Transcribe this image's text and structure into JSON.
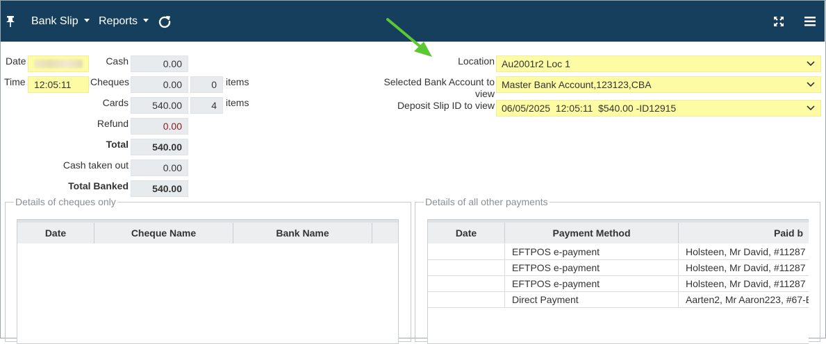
{
  "toolbar": {
    "pin_icon": "pin-icon",
    "bank_slip_label": "Bank Slip",
    "reports_label": "Reports",
    "refresh_icon": "refresh-icon",
    "fullscreen_icon": "expand-icon",
    "menu_icon": "hamburger-menu-icon",
    "bar_color": "#153f5c"
  },
  "form": {
    "date_label": "Date",
    "time_label": "Time",
    "time_value": "12:05:11",
    "cash_label": "Cash",
    "cash_value": "0.00",
    "cheques_label": "Cheques",
    "cheques_value": "0.00",
    "cheques_count": "0",
    "cheques_items": "items",
    "cards_label": "Cards",
    "cards_value": "540.00",
    "cards_count": "4",
    "cards_items": "items",
    "refund_label": "Refund",
    "refund_value": "0.00",
    "total_label": "Total",
    "total_value": "540.00",
    "cash_taken_out_label": "Cash taken out",
    "cash_taken_out_value": "0.00",
    "total_banked_label": "Total Banked",
    "total_banked_value": "540.00"
  },
  "selectors": {
    "location_label": "Location",
    "location_value": "Au2001r2 Loc 1",
    "bank_account_label_1": "Selected Bank Account to",
    "bank_account_label_2": "view",
    "bank_account_value": "Master Bank Account,123123,CBA",
    "deposit_slip_label": "Deposit Slip ID to view",
    "deposit_slip_value": "06/05/2025  12:05:11  $540.00 -ID12915",
    "highlight_color": "#fdfca4"
  },
  "cheques_panel": {
    "legend": "Details of cheques only",
    "columns": [
      "Date",
      "Cheque Name",
      "Bank Name"
    ]
  },
  "payments_panel": {
    "legend": "Details of all other payments",
    "columns": [
      "Date",
      "Payment Method",
      "Paid b"
    ],
    "rows": [
      {
        "date": "",
        "method": "EFTPOS e-payment",
        "paid_by": "Holsteen, Mr David, #11287"
      },
      {
        "date": "",
        "method": "EFTPOS e-payment",
        "paid_by": "Holsteen, Mr David, #11287"
      },
      {
        "date": "",
        "method": "EFTPOS e-payment",
        "paid_by": "Holsteen, Mr David, #11287"
      },
      {
        "date": "",
        "method": "Direct Payment",
        "paid_by": "Aarten2, Mr Aaron223, #67-E"
      }
    ]
  },
  "annotation": {
    "arrow_color": "#5cc832"
  }
}
